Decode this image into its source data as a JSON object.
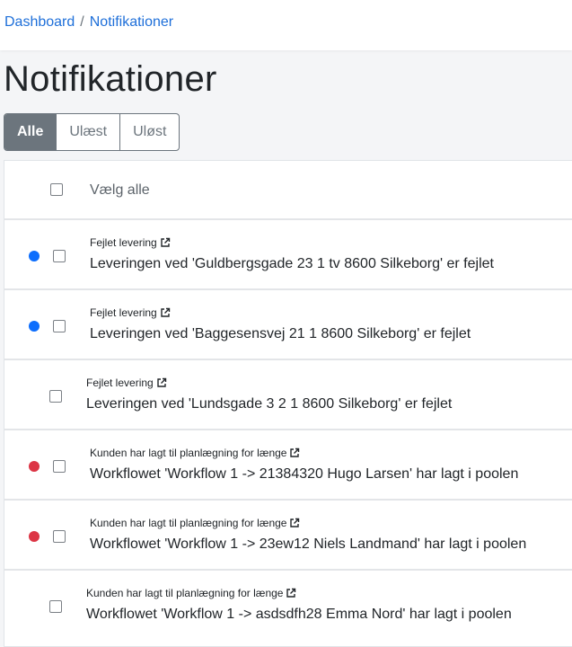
{
  "colors": {
    "link": "#1e6fd9",
    "unread_dot": "#0d6efd",
    "unresolved_dot": "#dc3545",
    "filter_active": "#6c757d"
  },
  "breadcrumb": {
    "items": [
      {
        "label": "Dashboard"
      },
      {
        "label": "Notifikationer"
      }
    ],
    "separator": "/"
  },
  "page_title": "Notifikationer",
  "filters": [
    {
      "label": "Alle",
      "active": true
    },
    {
      "label": "Ulæst",
      "active": false
    },
    {
      "label": "Uløst",
      "active": false
    }
  ],
  "list": {
    "select_all_label": "Vælg alle",
    "external_link_icon": "external-link-icon",
    "items": [
      {
        "type": "Fejlet levering",
        "message": "Leveringen ved 'Guldbergsgade 23 1 tv 8600 Silkeborg' er fejlet",
        "status": "unread"
      },
      {
        "type": "Fejlet levering",
        "message": "Leveringen ved 'Baggesensvej 21 1 8600 Silkeborg' er fejlet",
        "status": "unread"
      },
      {
        "type": "Fejlet levering",
        "message": "Leveringen ved 'Lundsgade 3 2 1 8600 Silkeborg' er fejlet",
        "status": "none"
      },
      {
        "type": "Kunden har lagt til planlægning for længe",
        "message": "Workflowet 'Workflow 1 -> 21384320 Hugo Larsen' har lagt i poolen",
        "status": "unresolved"
      },
      {
        "type": "Kunden har lagt til planlægning for længe",
        "message": "Workflowet 'Workflow 1 -> 23ew12 Niels Landmand' har lagt i poolen",
        "status": "unresolved"
      },
      {
        "type": "Kunden har lagt til planlægning for længe",
        "message": "Workflowet 'Workflow 1 -> asdsdfh28 Emma Nord' har lagt i poolen",
        "status": "none"
      }
    ]
  }
}
